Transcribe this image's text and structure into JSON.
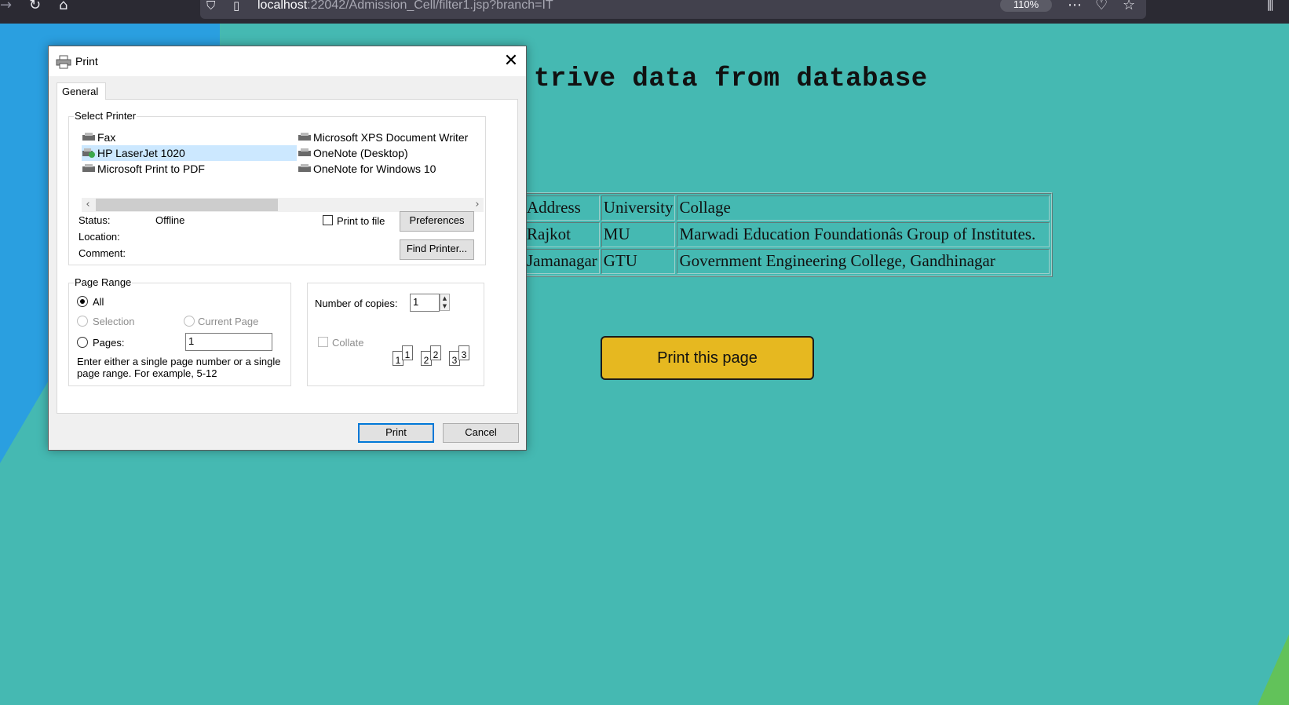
{
  "browser": {
    "url_host": "localhost",
    "url_rest": ":22042/Admission_Cell/filter1.jsp?branch=IT",
    "zoom": "110%",
    "icons": [
      "back-arrow-icon",
      "reload-icon",
      "home-icon",
      "shield-icon",
      "page-icon",
      "more-icon",
      "pocket-icon",
      "bookmark-star-icon",
      "library-icon"
    ]
  },
  "page": {
    "heading": "trive data from database",
    "table": {
      "header": [
        "Address",
        "University",
        "Collage"
      ],
      "rows": [
        [
          "Rajkot",
          "MU",
          "Marwadi Education Foundationâs Group of Institutes."
        ],
        [
          "Jamanagar",
          "GTU",
          "Government Engineering College, Gandhinagar"
        ]
      ]
    },
    "print_button": "Print this page"
  },
  "dialog": {
    "title": "Print",
    "tab": "General",
    "select_printer_label": "Select Printer",
    "printers": [
      {
        "name": "Fax",
        "icon": "fax-printer-icon"
      },
      {
        "name": "HP LaserJet 1020",
        "icon": "default-printer-icon",
        "selected": true
      },
      {
        "name": "Microsoft Print to PDF",
        "icon": "printer-icon"
      },
      {
        "name": "Microsoft XPS Document Writer",
        "icon": "printer-icon"
      },
      {
        "name": "OneNote (Desktop)",
        "icon": "printer-icon"
      },
      {
        "name": "OneNote for Windows 10",
        "icon": "printer-icon"
      }
    ],
    "status_label": "Status:",
    "status_value": "Offline",
    "location_label": "Location:",
    "comment_label": "Comment:",
    "print_to_file": "Print to file",
    "preferences": "Preferences",
    "find_printer": "Find Printer...",
    "page_range_label": "Page Range",
    "all": "All",
    "selection": "Selection",
    "current_page": "Current Page",
    "pages": "Pages:",
    "pages_value": "1",
    "page_range_hint": "Enter either a single page number or a single page range.  For example, 5-12",
    "copies_label": "Number of copies:",
    "copies_value": "1",
    "collate": "Collate",
    "collate_pages": [
      "1",
      "1",
      "2",
      "2",
      "3",
      "3"
    ],
    "print": "Print",
    "cancel": "Cancel"
  },
  "colors": {
    "page_bg": "#45b9b2",
    "button_bg": "#e6b820",
    "selection_bg": "#cce8ff",
    "default_button_border": "#0078d7"
  }
}
